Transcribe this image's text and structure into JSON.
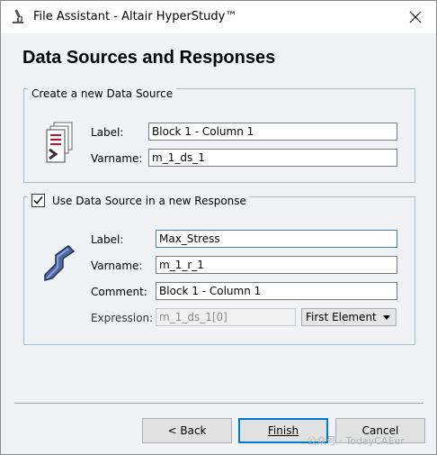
{
  "window": {
    "title": "File Assistant - Altair HyperStudy™",
    "app_icon": "microscope-icon",
    "close_icon": "close-icon"
  },
  "page": {
    "title": "Data Sources and Responses"
  },
  "data_source": {
    "group_title": "Create a new Data Source",
    "icon": "data-source-icon",
    "label_caption": "Label:",
    "label_value": "Block 1 - Column 1",
    "varname_caption": "Varname:",
    "varname_value": "m_1_ds_1"
  },
  "response": {
    "checkbox_label": "Use Data Source in a new Response",
    "checked": true,
    "icon": "response-icon",
    "label_caption": "Label:",
    "label_value": "Max_Stress",
    "varname_caption": "Varname:",
    "varname_value": "m_1_r_1",
    "comment_caption": "Comment:",
    "comment_value": "Block 1 - Column 1",
    "expression_caption": "Expression:",
    "expression_value": "m_1_ds_1[0]",
    "expression_mode": "First Element"
  },
  "buttons": {
    "back": "< Back",
    "finish": "Finish",
    "cancel": "Cancel"
  },
  "watermark": "公众号 · TodayCAEer",
  "colors": {
    "background": "#f0f2f5",
    "group_border": "#a9c0d3",
    "focus": "#0078d7"
  }
}
